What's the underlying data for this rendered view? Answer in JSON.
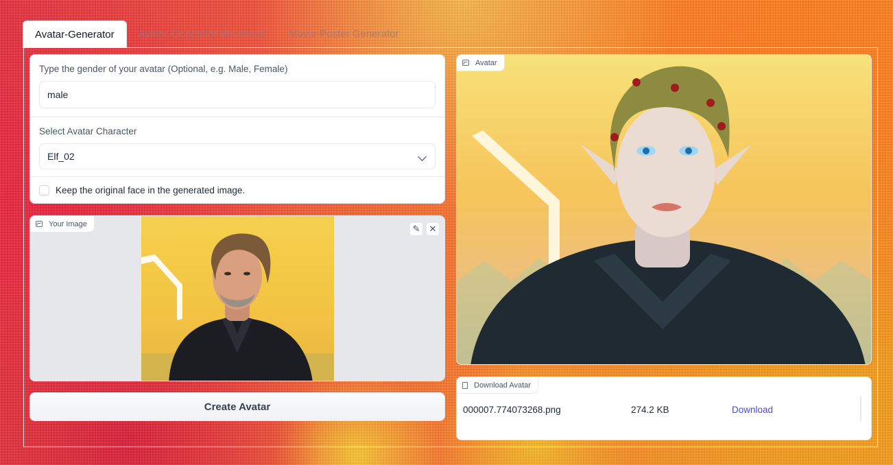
{
  "tabs": [
    {
      "label": "Avatar-Generator",
      "active": true
    },
    {
      "label": "Avatar-Generator Advanced",
      "active": false
    },
    {
      "label": "Movie-Poster Generator",
      "active": false
    }
  ],
  "form": {
    "gender_label": "Type the gender of your avatar (Optional, e.g. Male, Female)",
    "gender_value": "male",
    "character_label": "Select Avatar Character",
    "character_value": "Elf_02",
    "keep_face_label": "Keep the original face in the generated image.",
    "keep_face_checked": false
  },
  "your_image": {
    "label": "Your Image",
    "icon": "image-icon",
    "controls": [
      "edit-icon",
      "close-icon"
    ]
  },
  "create_button": "Create Avatar",
  "avatar": {
    "label": "Avatar",
    "icon": "image-icon"
  },
  "download": {
    "label": "Download Avatar",
    "icon": "file-icon",
    "filename": "000007.774073268.png",
    "size": "274.2 KB",
    "link": "Download"
  },
  "colors": {
    "link": "#4f46e5",
    "panel": "#ffffff"
  }
}
